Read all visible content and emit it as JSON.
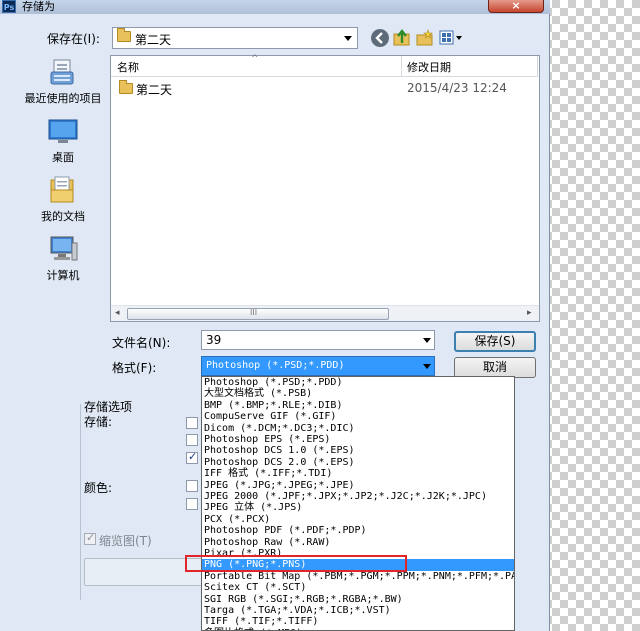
{
  "window": {
    "app_icon": "photoshop-icon",
    "title": "存储为",
    "close_glyph": "×"
  },
  "toolbar": {
    "save_in_label": "保存在(I):",
    "current_folder": "第二天",
    "icons": [
      "back-icon",
      "up-folder-icon",
      "new-folder-icon",
      "views-menu-icon"
    ]
  },
  "places": [
    {
      "label": "最近使用的项目",
      "icon": "recent-items-icon"
    },
    {
      "label": "桌面",
      "icon": "desktop-icon"
    },
    {
      "label": "我的文档",
      "icon": "documents-icon"
    },
    {
      "label": "计算机",
      "icon": "computer-icon"
    }
  ],
  "file_list": {
    "columns": [
      "名称",
      "修改日期"
    ],
    "sort_glyph": "^",
    "rows": [
      {
        "name": "第二天",
        "modified": "2015/4/23 12:24"
      }
    ],
    "scroll_grip": "III"
  },
  "filename": {
    "label": "文件名(N):",
    "value": "39"
  },
  "format": {
    "label": "格式(F):",
    "selected": "Photoshop (*.PSD;*.PDD)",
    "options": [
      "Photoshop (*.PSD;*.PDD)",
      "大型文档格式 (*.PSB)",
      "BMP (*.BMP;*.RLE;*.DIB)",
      "CompuServe GIF (*.GIF)",
      "Dicom (*.DCM;*.DC3;*.DIC)",
      "Photoshop EPS (*.EPS)",
      "Photoshop DCS 1.0 (*.EPS)",
      "Photoshop DCS 2.0 (*.EPS)",
      "IFF 格式 (*.IFF;*.TDI)",
      "JPEG (*.JPG;*.JPEG;*.JPE)",
      "JPEG 2000 (*.JPF;*.JPX;*.JP2;*.J2C;*.J2K;*.JPC)",
      "JPEG 立体 (*.JPS)",
      "PCX (*.PCX)",
      "Photoshop PDF (*.PDF;*.PDP)",
      "Photoshop Raw (*.RAW)",
      "Pixar (*.PXR)",
      "PNG (*.PNG;*.PNS)",
      "Portable Bit Map (*.PBM;*.PGM;*.PPM;*.PNM;*.PFM;*.PAM)",
      "Scitex CT (*.SCT)",
      "SGI RGB (*.SGI;*.RGB;*.RGBA;*.BW)",
      "Targa (*.TGA;*.VDA;*.ICB;*.VST)",
      "TIFF (*.TIF;*.TIFF)",
      "多图片格式 (*.MPO)"
    ],
    "highlighted_index": 16
  },
  "buttons": {
    "save": "保存(S)",
    "cancel": "取消"
  },
  "options": {
    "section_label": "存储选项",
    "storage_label": "存储:",
    "color_label": "颜色:",
    "thumbnail_label": "缩览图(T)"
  },
  "colors": {
    "selection": "#3399ff",
    "annotation_box": "#e0262a",
    "dialog_bg": "#dfe8f4"
  }
}
